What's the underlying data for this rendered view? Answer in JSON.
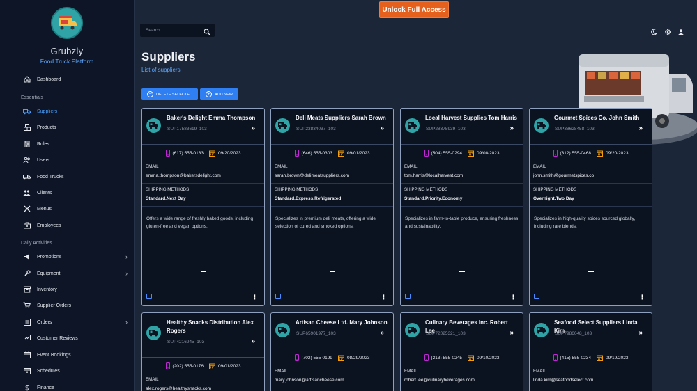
{
  "app": {
    "name": "Grubzly",
    "tagline": "Food Truck Platform"
  },
  "colors": {
    "accent": "#2f7ef2",
    "active_link": "#4aa0ff",
    "unlock": "#e4601c",
    "phone_icon": "#c026d3",
    "calendar_icon": "#f59e0b",
    "avatar": "#2fa3a6"
  },
  "topbar": {
    "unlock_label": "Unlock Full Access",
    "search_placeholder": "Search"
  },
  "sidebar": {
    "dashboard": "Dashboard",
    "section_essentials": "Essentials",
    "section_daily": "Daily Activities",
    "items": [
      {
        "label": "Suppliers",
        "icon": "truck-icon",
        "active": true
      },
      {
        "label": "Products",
        "icon": "boxes-icon"
      },
      {
        "label": "Roles",
        "icon": "roles-icon"
      },
      {
        "label": "Users",
        "icon": "users-icon"
      },
      {
        "label": "Food Trucks",
        "icon": "truck-icon"
      },
      {
        "label": "Clients",
        "icon": "clients-icon"
      },
      {
        "label": "Menus",
        "icon": "utensils-icon"
      },
      {
        "label": "Employees",
        "icon": "briefcase-icon"
      }
    ],
    "daily": [
      {
        "label": "Promotions",
        "icon": "megaphone-icon",
        "expandable": true
      },
      {
        "label": "Equipment",
        "icon": "wrench-icon",
        "expandable": true
      },
      {
        "label": "Inventory",
        "icon": "archive-icon"
      },
      {
        "label": "Supplier Orders",
        "icon": "cart-icon"
      },
      {
        "label": "Orders",
        "icon": "list-icon",
        "expandable": true
      },
      {
        "label": "Customer Reviews",
        "icon": "review-icon"
      },
      {
        "label": "Event Bookings",
        "icon": "calendar-icon"
      },
      {
        "label": "Schedules",
        "icon": "schedule-icon"
      },
      {
        "label": "Finance",
        "icon": "dollar-icon"
      }
    ]
  },
  "page": {
    "title": "Suppliers",
    "subtitle": "List of suppliers",
    "delete_label": "DELETE SELECTED",
    "add_label": "ADD NEW"
  },
  "labels": {
    "email": "EMAIL",
    "shipping": "SHIPPING METHODS"
  },
  "suppliers": [
    {
      "name": "Baker's Delight Emma Thompson",
      "id": "SUP17583619_103",
      "phone": "(617) 555-0133",
      "date": "09/20/2023",
      "email": "emma.thompson@bakersdelight.com",
      "shipping": "Standard,Next Day",
      "description": "Offers a wide range of freshly baked goods, including gluten-free and vegan options."
    },
    {
      "name": "Deli Meats Suppliers Sarah Brown",
      "id": "SUP23834037_103",
      "phone": "(646) 555-0303",
      "date": "09/01/2023",
      "email": "sarah.brown@delimeatsuppliers.com",
      "shipping": "Standard,Express,Refrigerated",
      "description": "Specializes in premium deli meats, offering a wide selection of cured and smoked options."
    },
    {
      "name": "Local Harvest Supplies Tom Harris",
      "id": "SUP28375939_103",
      "phone": "(504) 555-0294",
      "date": "09/08/2023",
      "email": "tom.harris@localharvest.com",
      "shipping": "Standard,Priority,Economy",
      "description": "Specializes in farm-to-table produce, ensuring freshness and sustainability."
    },
    {
      "name": "Gourmet Spices Co. John Smith",
      "id": "SUP38628458_103",
      "phone": "(312) 555-0468",
      "date": "09/20/2023",
      "email": "john.smith@gourmetspices.co",
      "shipping": "Overnight,Two Day",
      "description": "Specializes in high-quality spices sourced globally, including rare blends."
    },
    {
      "name": "Healthy Snacks Distribution Alex Rogers",
      "id": "SUP4216945_103",
      "phone": "(202) 555-0176",
      "date": "09/01/2023",
      "email": "alex.rogers@healthysnacks.com"
    },
    {
      "name": "Artisan Cheese Ltd. Mary Johnson",
      "id": "SUP65901977_103",
      "phone": "(702) 555-0199",
      "date": "08/29/2023",
      "email": "mary.johnson@artisancheese.com"
    },
    {
      "name": "Culinary Beverages Inc. Robert Lee",
      "id": "SUP72025321_103",
      "phone": "(213) 555-0245",
      "date": "09/10/2023",
      "email": "robert.lee@culinarybeverages.com"
    },
    {
      "name": "Seafood Select Suppliers Linda Kim",
      "id": "SUP7986048_103",
      "phone": "(415) 555-0234",
      "date": "09/19/2023",
      "email": "linda.kim@seafoodselect.com"
    }
  ]
}
